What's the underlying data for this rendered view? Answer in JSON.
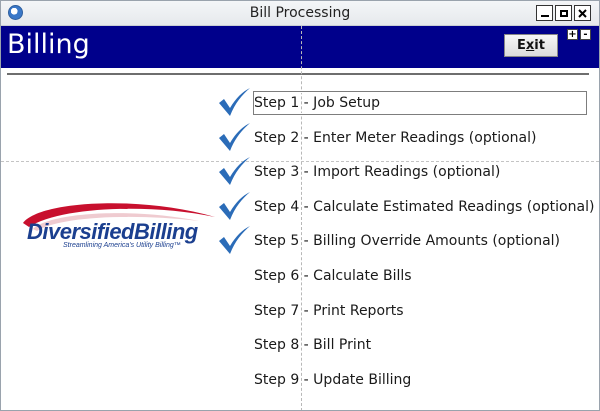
{
  "window": {
    "title": "Bill Processing"
  },
  "header": {
    "title": "Billing",
    "exit_label_first": "E",
    "exit_label_underlined": "x",
    "exit_label_rest": "it",
    "plus_label": "+",
    "minus_label": "-"
  },
  "logo": {
    "name_part1": "Diversified",
    "name_part2": "Billing",
    "tagline": "Streamlining America's Utility Billing™"
  },
  "steps": [
    {
      "label": "Step 1 - Job Setup",
      "completed": true,
      "selected": true
    },
    {
      "label": "Step 2 - Enter Meter Readings (optional)",
      "completed": true,
      "selected": false
    },
    {
      "label": "Step 3 - Import Readings (optional)",
      "completed": true,
      "selected": false
    },
    {
      "label": "Step 4 - Calculate Estimated Readings (optional)",
      "completed": true,
      "selected": false
    },
    {
      "label": "Step 5 - Billing Override Amounts (optional)",
      "completed": true,
      "selected": false
    },
    {
      "label": "Step 6 - Calculate Bills",
      "completed": false,
      "selected": false
    },
    {
      "label": "Step 7 - Print Reports",
      "completed": false,
      "selected": false
    },
    {
      "label": "Step 8 - Bill Print",
      "completed": false,
      "selected": false
    },
    {
      "label": "Step 9 - Update Billing",
      "completed": false,
      "selected": false
    }
  ],
  "colors": {
    "header_bg": "#00008b",
    "check": "#2b6cb8",
    "logo_blue": "#1b3f8f",
    "logo_red": "#c8102e"
  },
  "icons": {
    "app": "app-globe-icon",
    "check": "checkmark-icon"
  }
}
